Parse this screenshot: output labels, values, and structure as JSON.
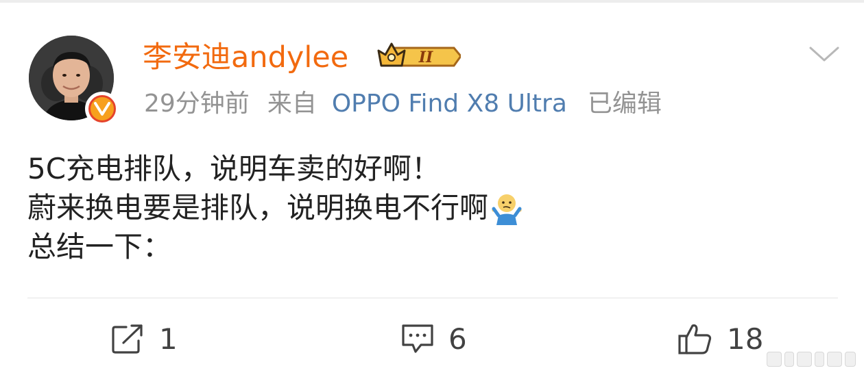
{
  "post": {
    "author": {
      "name": "李安迪andylee",
      "verified_badge": "V",
      "vip_level": "II"
    },
    "meta": {
      "time": "29分钟前",
      "source_prefix": "来自",
      "device": "OPPO Find X8 Ultra",
      "edited": "已编辑"
    },
    "content_lines": [
      "5C充电排队，说明车卖的好啊！",
      "蔚来换电要是排队，说明换电不行啊",
      "总结一下："
    ],
    "emoji": "shrug-emoji",
    "actions": {
      "repost_count": "1",
      "comment_count": "6",
      "like_count": "18"
    }
  },
  "colors": {
    "username": "#f26a0f",
    "device_link": "#507daf",
    "meta_text": "#939393",
    "body_text": "#222222",
    "action_text": "#424242"
  }
}
